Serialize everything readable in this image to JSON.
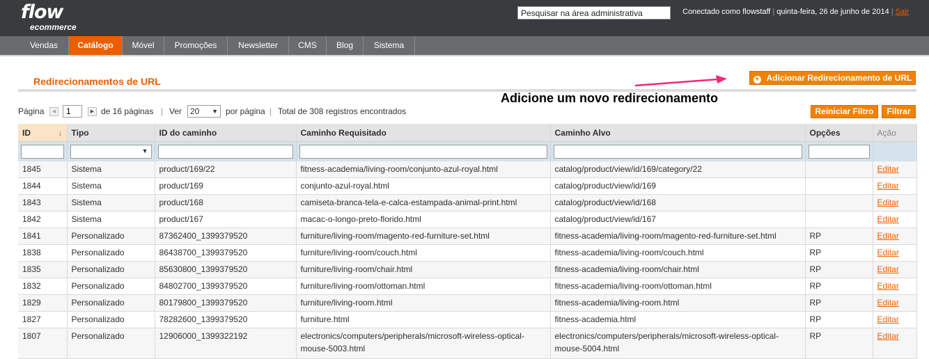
{
  "header": {
    "logo_main": "flow",
    "logo_sub": "ecommerce",
    "search_placeholder": "Pesquisar na área administrativa",
    "user": "Conectado como flowstaff",
    "date": "quinta-feira, 26 de junho de 2014",
    "logout": "Sair"
  },
  "nav": {
    "items": [
      {
        "label": "Vendas"
      },
      {
        "label": "Catálogo",
        "active": true
      },
      {
        "label": "Móvel"
      },
      {
        "label": "Promoções"
      },
      {
        "label": "Newsletter"
      },
      {
        "label": "CMS"
      },
      {
        "label": "Blog"
      },
      {
        "label": "Sistema"
      }
    ]
  },
  "page": {
    "title": "Redirecionamentos de URL",
    "add_button": "Adicionar Redirecionamento de URL",
    "annotation": "Adicione um novo redirecionamento"
  },
  "pager": {
    "page_label": "Página",
    "page_value": "1",
    "of_pages": "de 16 páginas",
    "view_label": "Ver",
    "per_page_value": "20",
    "per_page_label": "por página",
    "total": "Total de 308 registros encontrados",
    "reset_button": "Reiniciar Filtro",
    "filter_button": "Filtrar"
  },
  "grid": {
    "columns": [
      "ID",
      "Tipo",
      "ID do caminho",
      "Caminho Requisitado",
      "Caminho Alvo",
      "Opções",
      "Ação"
    ],
    "rows": [
      [
        "1845",
        "Sistema",
        "product/169/22",
        "fitness-academia/living-room/conjunto-azul-royal.html",
        "catalog/product/view/id/169/category/22",
        "",
        "Editar"
      ],
      [
        "1844",
        "Sistema",
        "product/169",
        "conjunto-azul-royal.html",
        "catalog/product/view/id/169",
        "",
        "Editar"
      ],
      [
        "1843",
        "Sistema",
        "product/168",
        "camiseta-branca-tela-e-calca-estampada-animal-print.html",
        "catalog/product/view/id/168",
        "",
        "Editar"
      ],
      [
        "1842",
        "Sistema",
        "product/167",
        "macac-o-longo-preto-florido.html",
        "catalog/product/view/id/167",
        "",
        "Editar"
      ],
      [
        "1841",
        "Personalizado",
        "87362400_1399379520",
        "furniture/living-room/magento-red-furniture-set.html",
        "fitness-academia/living-room/magento-red-furniture-set.html",
        "RP",
        "Editar"
      ],
      [
        "1838",
        "Personalizado",
        "86438700_1399379520",
        "furniture/living-room/couch.html",
        "fitness-academia/living-room/couch.html",
        "RP",
        "Editar"
      ],
      [
        "1835",
        "Personalizado",
        "85630800_1399379520",
        "furniture/living-room/chair.html",
        "fitness-academia/living-room/chair.html",
        "RP",
        "Editar"
      ],
      [
        "1832",
        "Personalizado",
        "84802700_1399379520",
        "furniture/living-room/ottoman.html",
        "fitness-academia/living-room/ottoman.html",
        "RP",
        "Editar"
      ],
      [
        "1829",
        "Personalizado",
        "80179800_1399379520",
        "furniture/living-room.html",
        "fitness-academia/living-room.html",
        "RP",
        "Editar"
      ],
      [
        "1827",
        "Personalizado",
        "78282600_1399379520",
        "furniture.html",
        "fitness-academia.html",
        "RP",
        "Editar"
      ],
      [
        "1807",
        "Personalizado",
        "12906000_1399322192",
        "electronics/computers/peripherals/microsoft-wireless-optical-mouse-5003.html",
        "electronics/computers/peripherals/microsoft-wireless-optical-mouse-5004.html",
        "RP",
        "Editar"
      ]
    ]
  },
  "colors": {
    "accent": "#eb5e00",
    "button": "#f18200",
    "header_bg": "#3a3b3e",
    "nav_bg": "#6a6b6e"
  }
}
